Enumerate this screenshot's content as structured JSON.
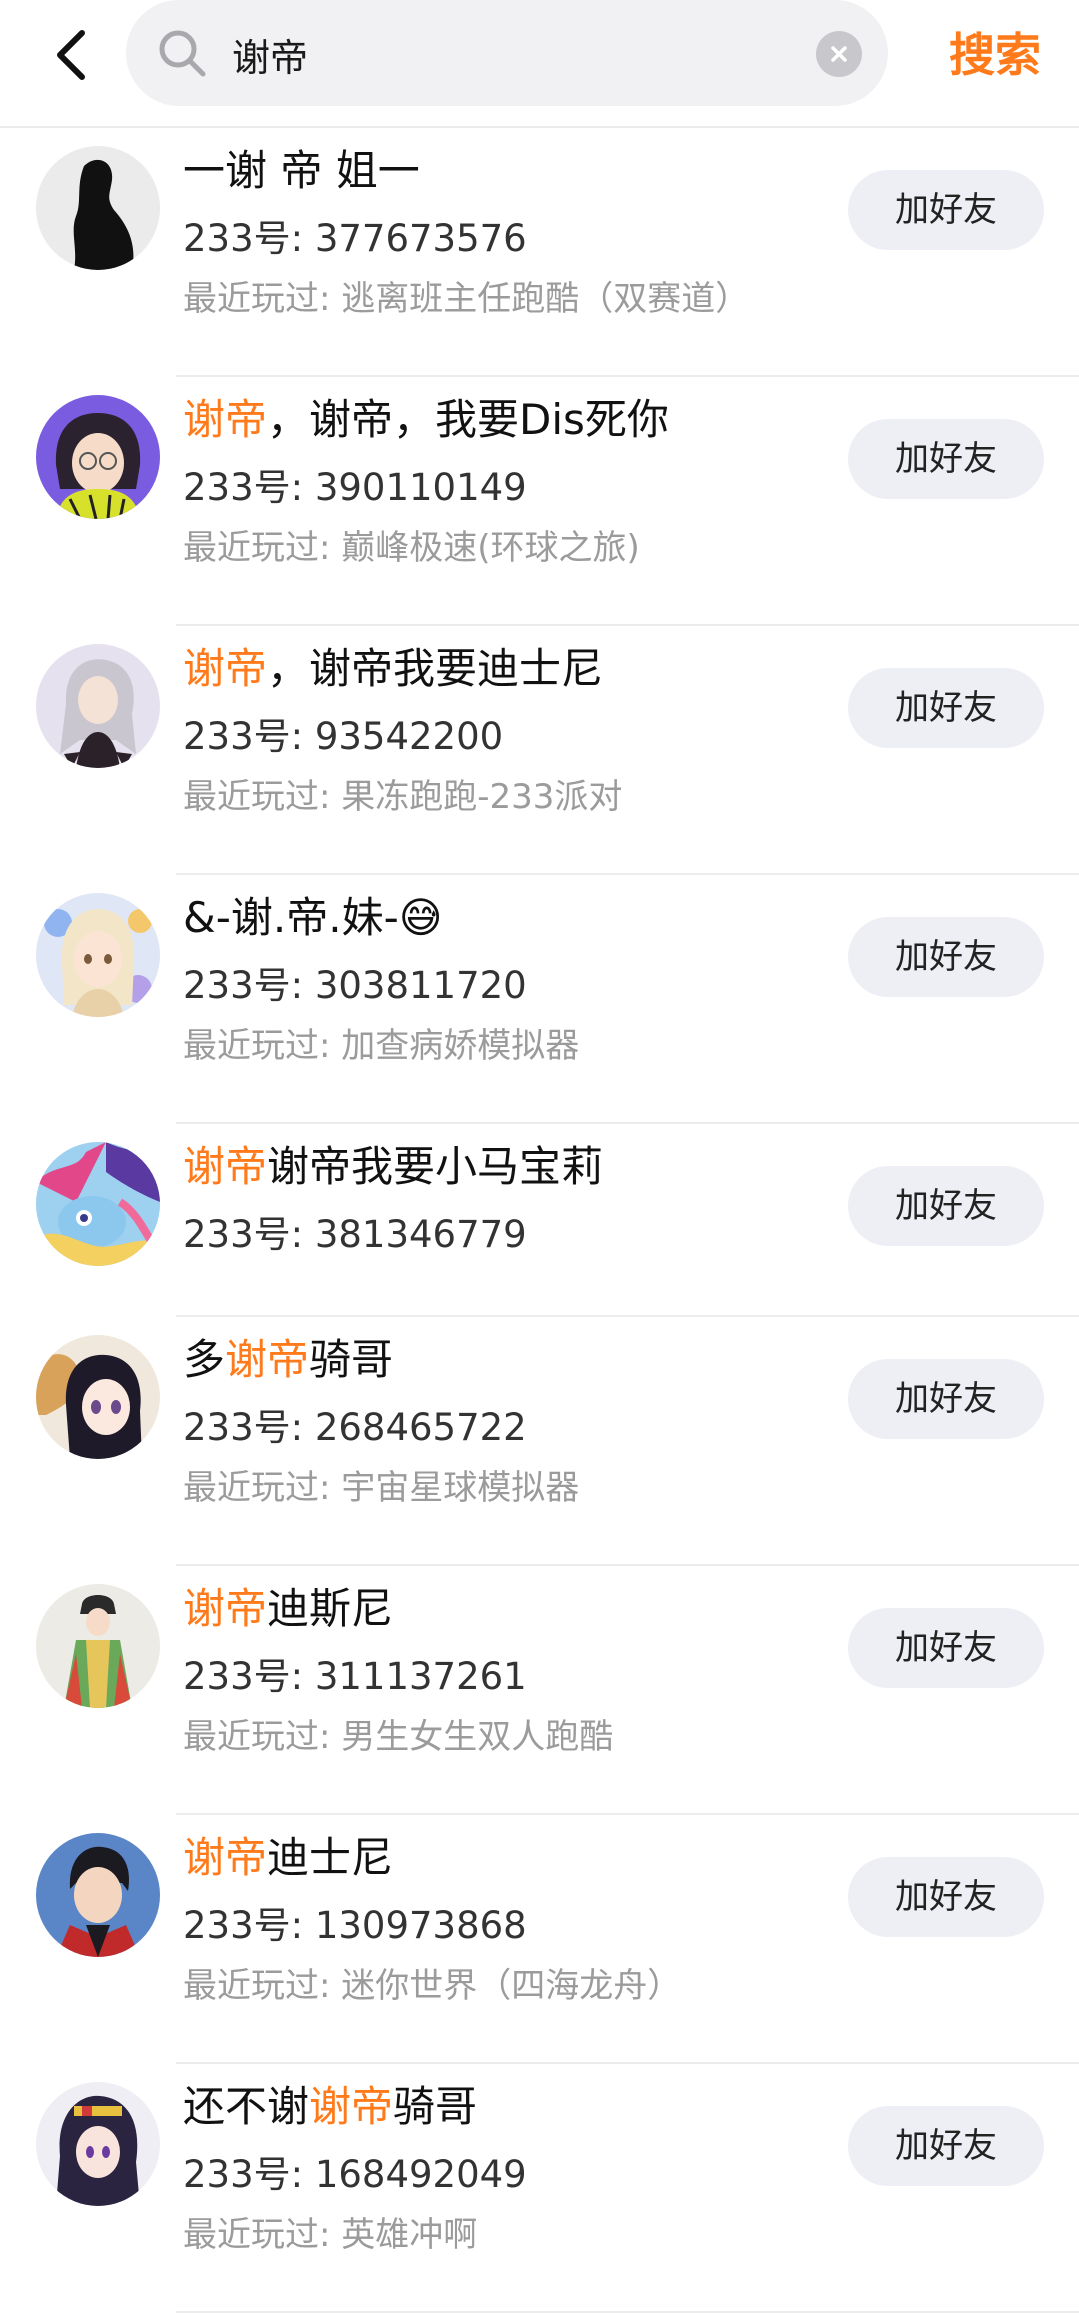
{
  "header": {
    "search_value": "谢帝",
    "search_button_label": "搜索"
  },
  "colors": {
    "accent": "#ff7a1a",
    "button_bg": "#eeeff5",
    "secondary_text": "#9b9b9b"
  },
  "icons": [
    "back-chevron-icon",
    "search-icon",
    "clear-icon"
  ],
  "results": [
    {
      "name_parts": [
        {
          "text": "一谢  帝  姐一",
          "highlight": false
        }
      ],
      "uid": "233号: 377673576",
      "recent": "最近玩过: 逃离班主任跑酷（双赛道）",
      "add_label": "加好友"
    },
    {
      "name_parts": [
        {
          "text": "谢帝",
          "highlight": true
        },
        {
          "text": "，谢帝，我要Dis死你",
          "highlight": false
        }
      ],
      "uid": "233号: 390110149",
      "recent": "最近玩过: 巅峰极速(环球之旅)",
      "add_label": "加好友"
    },
    {
      "name_parts": [
        {
          "text": "谢帝",
          "highlight": true
        },
        {
          "text": "，谢帝我要迪士尼",
          "highlight": false
        }
      ],
      "uid": "233号: 93542200",
      "recent": "最近玩过: 果冻跑跑-233派对",
      "add_label": "加好友"
    },
    {
      "name_parts": [
        {
          "text": "&-谢.帝.妹-😅",
          "highlight": false
        }
      ],
      "uid": "233号: 303811720",
      "recent": "最近玩过: 加查病娇模拟器",
      "add_label": "加好友"
    },
    {
      "name_parts": [
        {
          "text": "谢帝",
          "highlight": true
        },
        {
          "text": "谢帝我要小马宝莉",
          "highlight": false
        }
      ],
      "uid": "233号: 381346779",
      "recent": "",
      "add_label": "加好友"
    },
    {
      "name_parts": [
        {
          "text": "多",
          "highlight": false
        },
        {
          "text": "谢帝",
          "highlight": true
        },
        {
          "text": "骑哥",
          "highlight": false
        }
      ],
      "uid": "233号: 268465722",
      "recent": "最近玩过: 宇宙星球模拟器",
      "add_label": "加好友"
    },
    {
      "name_parts": [
        {
          "text": "谢帝",
          "highlight": true
        },
        {
          "text": "迪斯尼",
          "highlight": false
        }
      ],
      "uid": "233号: 311137261",
      "recent": "最近玩过: 男生女生双人跑酷",
      "add_label": "加好友"
    },
    {
      "name_parts": [
        {
          "text": "谢帝",
          "highlight": true
        },
        {
          "text": "迪士尼",
          "highlight": false
        }
      ],
      "uid": "233号: 130973868",
      "recent": "最近玩过: 迷你世界（四海龙舟）",
      "add_label": "加好友"
    },
    {
      "name_parts": [
        {
          "text": "还不谢",
          "highlight": false
        },
        {
          "text": "谢帝",
          "highlight": true
        },
        {
          "text": "骑哥",
          "highlight": false
        }
      ],
      "uid": "233号: 168492049",
      "recent": "最近玩过: 英雄冲啊",
      "add_label": "加好友"
    }
  ]
}
